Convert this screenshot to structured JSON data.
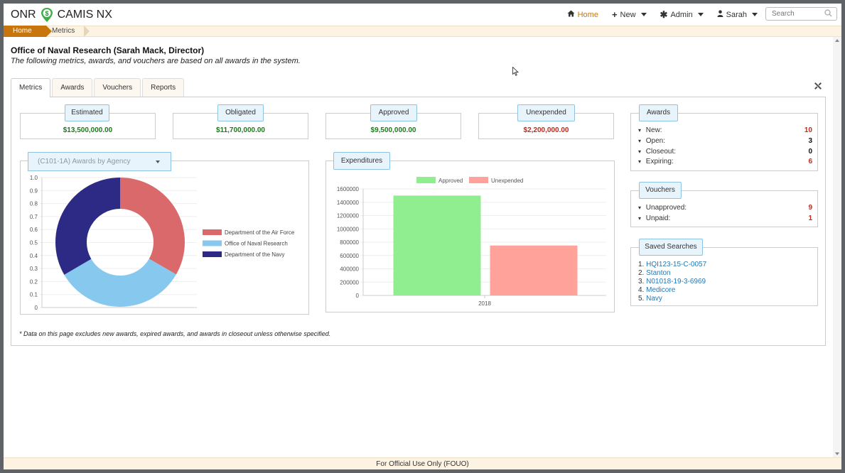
{
  "navbar": {
    "brand_left": "ONR",
    "brand_right": "CAMIS NX",
    "home_label": "Home",
    "new_label": "New",
    "admin_label": "Admin",
    "user_label": "Sarah",
    "search_placeholder": "Search"
  },
  "breadcrumb": {
    "home": "Home",
    "current": "Metrics"
  },
  "header": {
    "title": "Office of Naval Research (Sarah Mack, Director)",
    "subtitle": "The following metrics, awards, and vouchers are based on all awards in the system."
  },
  "tabs": [
    "Metrics",
    "Awards",
    "Vouchers",
    "Reports"
  ],
  "metrics": [
    {
      "label": "Estimated",
      "value": "$13,500,000.00",
      "color": "#1c7a1c"
    },
    {
      "label": "Obligated",
      "value": "$11,700,000.00",
      "color": "#1c7a1c"
    },
    {
      "label": "Approved",
      "value": "$9,500,000.00",
      "color": "#1c7a1c"
    },
    {
      "label": "Unexpended",
      "value": "$2,200,000.00",
      "color": "#c0291b"
    }
  ],
  "awards_panel": {
    "title": "Awards",
    "rows": [
      {
        "label": "New:",
        "value": "10",
        "color": "red"
      },
      {
        "label": "Open:",
        "value": "3",
        "color": "black"
      },
      {
        "label": "Closeout:",
        "value": "0",
        "color": "black"
      },
      {
        "label": "Expiring:",
        "value": "6",
        "color": "red"
      }
    ]
  },
  "vouchers_panel": {
    "title": "Vouchers",
    "rows": [
      {
        "label": "Unapproved:",
        "value": "9",
        "color": "red"
      },
      {
        "label": "Unpaid:",
        "value": "1",
        "color": "red"
      }
    ]
  },
  "saved_searches": {
    "title": "Saved Searches",
    "items": [
      {
        "num": "1.",
        "label": "HQI123-15-C-0057"
      },
      {
        "num": "2.",
        "label": "Stanton"
      },
      {
        "num": "3.",
        "label": "N01018-19-3-6969"
      },
      {
        "num": "4.",
        "label": "Medicore"
      },
      {
        "num": "5.",
        "label": "Navy"
      }
    ]
  },
  "donut_selector": "(C101-1A) Awards by Agency",
  "expenditures_title": "Expenditures",
  "chart_data": [
    {
      "type": "pie",
      "variant": "donut",
      "title": "",
      "y_ticks": [
        "0",
        "0.1",
        "0.2",
        "0.3",
        "0.4",
        "0.5",
        "0.6",
        "0.7",
        "0.8",
        "0.9",
        "1.0"
      ],
      "slices": [
        {
          "name": "Department of the Air Force",
          "value": 0.333,
          "color": "#d9696b"
        },
        {
          "name": "Office of Naval Research",
          "value": 0.333,
          "color": "#87c8ee"
        },
        {
          "name": "Department of the Navy",
          "value": 0.334,
          "color": "#2d2a85"
        }
      ],
      "legend_position": "right"
    },
    {
      "type": "bar",
      "title": "",
      "categories": [
        "2018"
      ],
      "series": [
        {
          "name": "Approved",
          "values": [
            1500000
          ],
          "color": "#90ee90"
        },
        {
          "name": "Unexpended",
          "values": [
            750000
          ],
          "color": "#ffa39a"
        }
      ],
      "ylim": [
        0,
        1600000
      ],
      "y_ticks": [
        "0",
        "200000",
        "400000",
        "600000",
        "800000",
        "1000000",
        "1200000",
        "1400000",
        "1600000"
      ],
      "grid": true,
      "legend_position": "top"
    }
  ],
  "footnote": "* Data on this page excludes new awards, expired awards, and awards in closeout unless otherwise specified.",
  "footer": "For Official Use Only (FOUO)"
}
